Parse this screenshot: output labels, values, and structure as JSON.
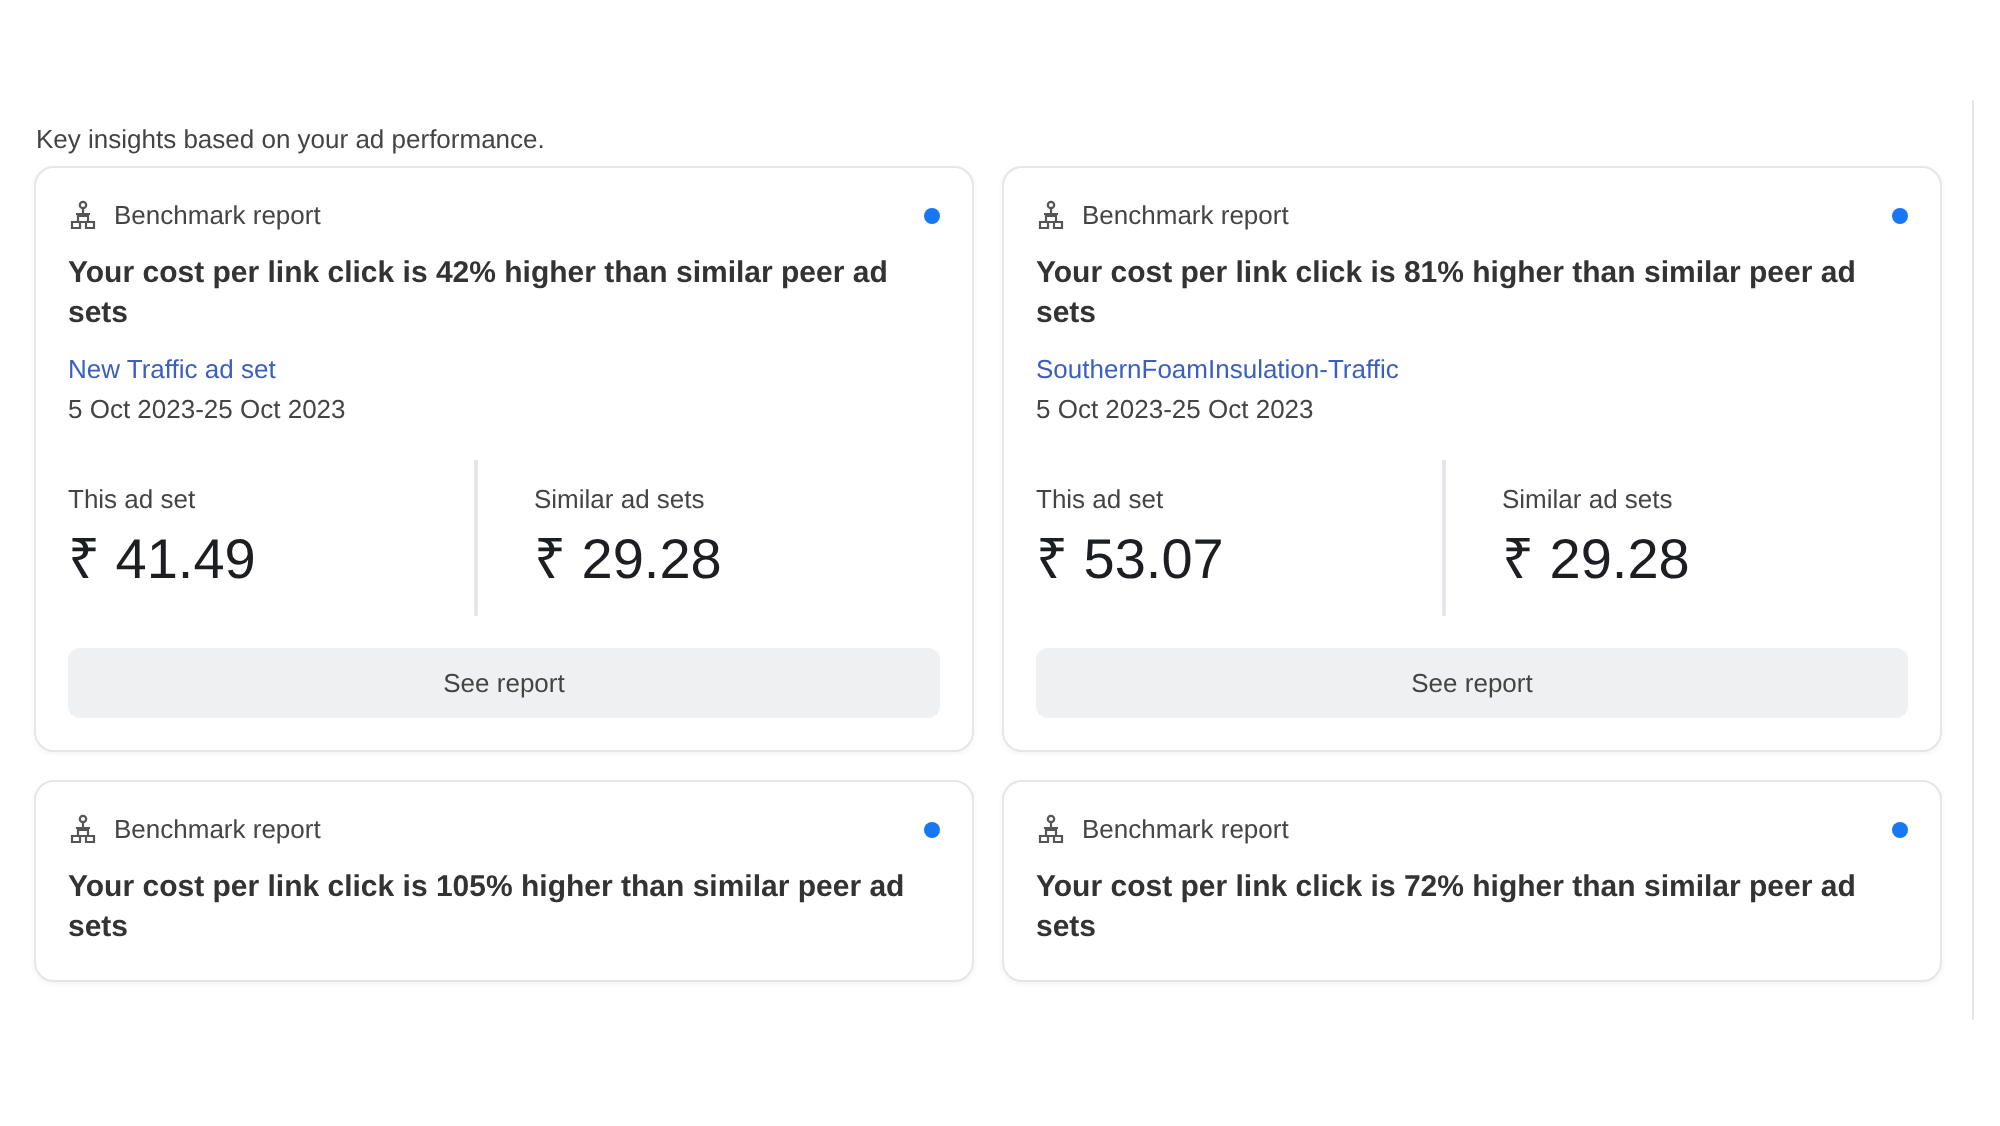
{
  "intro": "Key insights based on your ad performance.",
  "cards": [
    {
      "category": "Benchmark report",
      "unread": true,
      "headline": "Your cost per link click is 42% higher than similar peer ad sets",
      "ad_set": "New Traffic ad set",
      "date_range": "5 Oct 2023-25 Oct 2023",
      "metrics": [
        {
          "label": "This ad set",
          "value": "₹ 41.49"
        },
        {
          "label": "Similar ad sets",
          "value": "₹ 29.28"
        }
      ],
      "button": "See report"
    },
    {
      "category": "Benchmark report",
      "unread": true,
      "headline": "Your cost per link click is 81% higher than similar peer ad sets",
      "ad_set": "SouthernFoamInsulation-Traffic",
      "date_range": "5 Oct 2023-25 Oct 2023",
      "metrics": [
        {
          "label": "This ad set",
          "value": "₹ 53.07"
        },
        {
          "label": "Similar ad sets",
          "value": "₹ 29.28"
        }
      ],
      "button": "See report"
    },
    {
      "category": "Benchmark report",
      "unread": true,
      "headline": "Your cost per link click is 105% higher than similar peer ad sets"
    },
    {
      "category": "Benchmark report",
      "unread": true,
      "headline": "Your cost per link click is 72% higher than similar peer ad sets"
    }
  ]
}
